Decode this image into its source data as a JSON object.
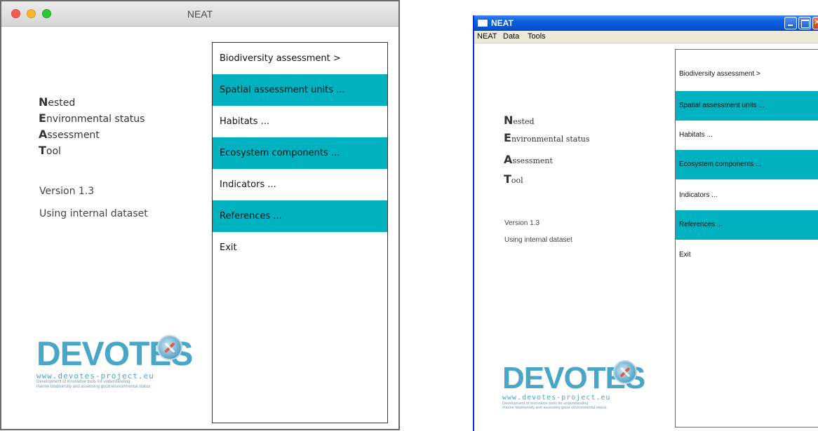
{
  "mac": {
    "window_title": "NEAT",
    "acronym": [
      {
        "initial": "N",
        "rest": "ested"
      },
      {
        "initial": "E",
        "rest": "nvironmental status"
      },
      {
        "initial": "A",
        "rest": "ssessment"
      },
      {
        "initial": "T",
        "rest": "ool"
      }
    ],
    "version": "Version 1.3",
    "dataset": "Using internal dataset",
    "menu": [
      {
        "label": "Biodiversity assessment >",
        "highlight": false
      },
      {
        "label": "Spatial assessment units ...",
        "highlight": true
      },
      {
        "label": "Habitats ...",
        "highlight": false
      },
      {
        "label": "Ecosystem components ...",
        "highlight": true
      },
      {
        "label": "Indicators ...",
        "highlight": false
      },
      {
        "label": "References ...",
        "highlight": true
      },
      {
        "label": "Exit",
        "highlight": false
      }
    ],
    "logo": {
      "word": "DEVOTES",
      "url": "www.devotes-project.eu",
      "tagline_1": "Development of innovative tools for understanding",
      "tagline_2": "marine biodiversity and assessing good environmental status"
    }
  },
  "win": {
    "window_title": "NEAT",
    "menubar": [
      "NEAT",
      "Data",
      "Tools"
    ],
    "acronym": [
      {
        "initial": "N",
        "rest": "ested"
      },
      {
        "initial": "E",
        "rest": "nvironmental status"
      },
      {
        "initial": "A",
        "rest": "ssessment"
      },
      {
        "initial": "T",
        "rest": "ool"
      }
    ],
    "version": "Version 1.3",
    "dataset": "Using internal dataset",
    "menu": [
      {
        "label": "Biodiversity assessment >",
        "highlight": false
      },
      {
        "label": "Spatial assessment units ...",
        "highlight": true
      },
      {
        "label": "Habitats ...",
        "highlight": false
      },
      {
        "label": "Ecosystem components ...",
        "highlight": true
      },
      {
        "label": "Indicators ...",
        "highlight": false
      },
      {
        "label": "References ...",
        "highlight": true
      },
      {
        "label": "Exit",
        "highlight": false
      }
    ],
    "logo": {
      "word": "DEVOTES",
      "url": "www.devotes-project.eu",
      "tagline_1": "Development of innovative tools for understanding",
      "tagline_2": "marine biodiversity and assessing good environmental status"
    }
  },
  "colors": {
    "menu_highlight": "#00b2bf",
    "logo_blue": "#49a6c6",
    "win_titlebar": "#0a5ddd"
  },
  "icons": [
    "close-traffic-light",
    "minimize-traffic-light",
    "maximize-traffic-light",
    "window-app-icon",
    "minimize-icon",
    "maximize-icon",
    "close-icon",
    "compass-icon"
  ]
}
